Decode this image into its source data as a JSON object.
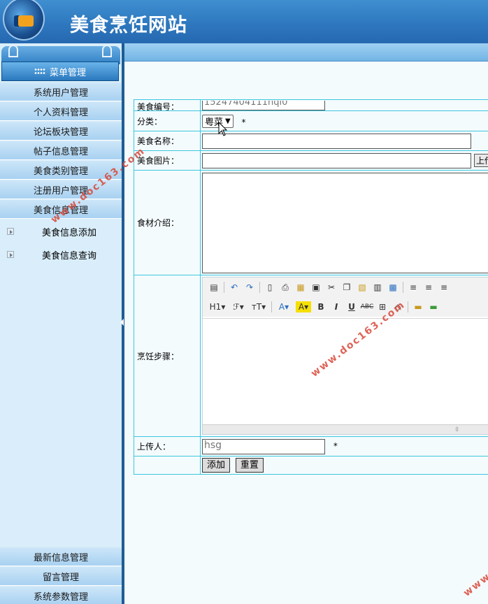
{
  "header": {
    "title": "美食烹饪网站"
  },
  "sidebar": {
    "menu_head": "菜单管理",
    "items": [
      "系统用户管理",
      "个人资料管理",
      "论坛板块管理",
      "帖子信息管理",
      "美食类别管理",
      "注册用户管理",
      "美食信息管理"
    ],
    "sub_items": [
      "美食信息添加",
      "美食信息查询"
    ],
    "bottom_items": [
      "最新信息管理",
      "留言管理",
      "系统参数管理"
    ]
  },
  "form": {
    "code_label": "美食编号：",
    "code_value": "15247404111hqi0",
    "category_label": "分类：",
    "category_value": "粤菜",
    "name_label": "美食名称：",
    "image_label": "美食图片：",
    "upload_button": "上传",
    "ingredients_label": "食材介绍：",
    "steps_label": "烹饪步骤：",
    "uploader_label": "上传人：",
    "uploader_value": "hsg",
    "required_mark": "*",
    "submit_button": "添加",
    "reset_button": "重置"
  },
  "watermark": "www.doc163.com"
}
